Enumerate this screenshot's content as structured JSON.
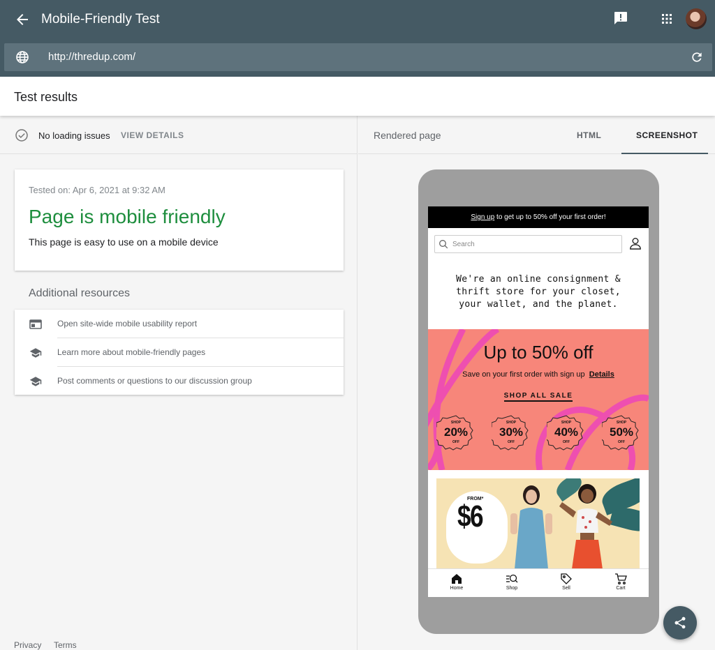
{
  "header": {
    "title": "Mobile-Friendly Test",
    "url": "http://thredup.com/"
  },
  "results": {
    "title": "Test results",
    "status": "No loading issues",
    "view_details": "VIEW DETAILS",
    "tested_on": "Tested on: Apr 6, 2021 at 9:32 AM",
    "verdict": "Page is mobile friendly",
    "verdict_sub": "This page is easy to use on a mobile device"
  },
  "resources": {
    "title": "Additional resources",
    "items": [
      {
        "label": "Open site-wide mobile usability report",
        "icon": "report-icon"
      },
      {
        "label": "Learn more about mobile-friendly pages",
        "icon": "school-icon"
      },
      {
        "label": "Post comments or questions to our discussion group",
        "icon": "school-icon"
      }
    ]
  },
  "footer": {
    "privacy": "Privacy",
    "terms": "Terms"
  },
  "preview": {
    "label": "Rendered page",
    "tabs": [
      {
        "label": "HTML",
        "active": false
      },
      {
        "label": "SCREENSHOT",
        "active": true
      }
    ]
  },
  "mobile": {
    "banner_link": "Sign up",
    "banner_rest": " to get up to 50% off your first order!",
    "search_placeholder": "Search",
    "tagline_1": "We're an online consignment &",
    "tagline_2": "thrift store for your closet,",
    "tagline_3": "your wallet, and the planet.",
    "sale_headline": "Up to 50% off",
    "sale_sub": "Save on your first order with sign up",
    "sale_details": "Details",
    "sale_cta": "SHOP ALL SALE",
    "badge_shop": "SHOP",
    "badge_off": "OFF",
    "badges": [
      "20%",
      "30%",
      "40%",
      "50%"
    ],
    "hero_from": "FROM*",
    "hero_price": "$6",
    "tabbar": [
      "Home",
      "Shop",
      "Sell",
      "Cart"
    ]
  },
  "colors": {
    "header": "#455a64",
    "url_bar": "#5e727c",
    "success": "#1e8e3e",
    "sale_bg": "#f7867a",
    "sale_swoosh": "#ee4fb0"
  }
}
